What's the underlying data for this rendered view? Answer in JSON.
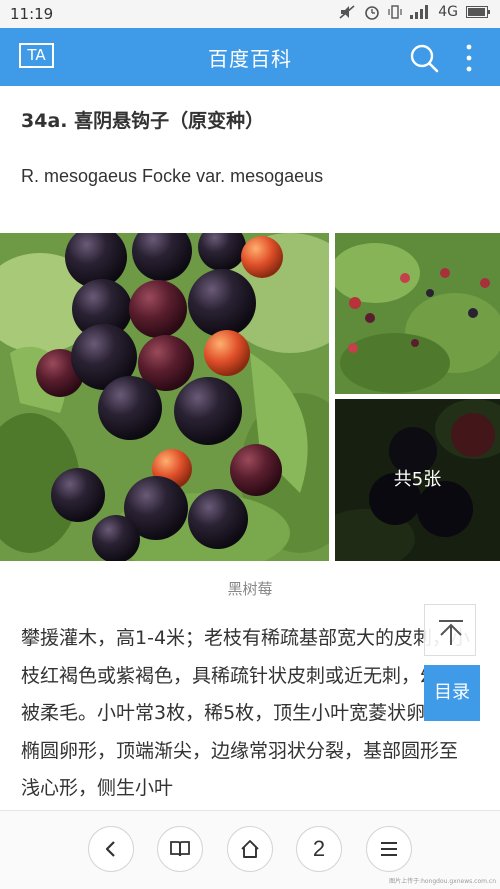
{
  "status_bar": {
    "time": "11:19",
    "network": "4G"
  },
  "app_bar": {
    "title": "百度百科",
    "ta_label": "TA",
    "icons": [
      "ta-icon",
      "search-icon",
      "more-vertical-icon"
    ]
  },
  "article": {
    "heading": "34a. 喜阴悬钩子（原变种）",
    "latin_name": "R. mesogaeus Focke var. mesogaeus",
    "gallery": {
      "count_label": "共5张",
      "caption": "黑树莓"
    },
    "body": "攀援灌木，高1-4米；老枝有稀疏基部宽大的皮刺，小枝红褐色或紫褐色，具稀疏针状皮刺或近无刺，幼时被柔毛。小叶常3枚，稀5枚，顶生小叶宽菱状卵形或椭圆卵形，顶端渐尖，边缘常羽状分裂，基部圆形至浅心形，侧生小叶"
  },
  "floating": {
    "toc_label": "目录",
    "icons": [
      "back-to-top-icon"
    ]
  },
  "bottom_nav": {
    "page_count": "2",
    "icons": [
      "back-icon",
      "book-icon",
      "home-icon",
      "menu-icon"
    ]
  },
  "watermark": "图片上传于:hongdou.gxnews.com.cn",
  "colors": {
    "brand_blue": "#3f9be8"
  }
}
